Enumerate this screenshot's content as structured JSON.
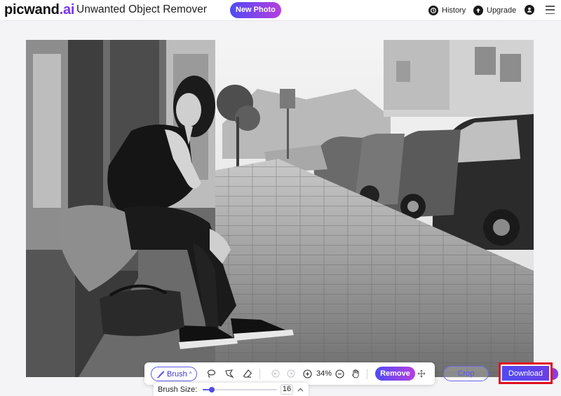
{
  "header": {
    "logo_main": "picwand",
    "logo_accent": ".ai",
    "app_title": "Unwanted Object Remover",
    "new_photo_label": "New Photo",
    "history_label": "History",
    "upgrade_label": "Upgrade",
    "icons": {
      "history": "history-clock-icon",
      "upgrade": "upgrade-arrow-icon",
      "account": "user-avatar-icon",
      "menu": "hamburger-menu-icon"
    }
  },
  "toolbar": {
    "brush_label": "Brush",
    "zoom_level": "34%",
    "remove_label": "Remove",
    "icons": [
      "brush-icon",
      "chevron-up-icon",
      "lasso-icon",
      "polygon-lasso-icon",
      "eraser-icon",
      "undo-icon",
      "redo-icon",
      "zoom-in-icon",
      "zoom-out-icon",
      "hand-pan-icon",
      "move-icon"
    ]
  },
  "actions": {
    "crop_label": "Crop",
    "download_label": "Download"
  },
  "brush_size": {
    "label": "Brush Size:",
    "value": "16",
    "slider_fraction": 0.12
  },
  "colors": {
    "accent_start": "#4f4bf2",
    "accent_end": "#b63fe0",
    "logo_accent": "#7a36f0",
    "highlight_border": "#e0101e"
  }
}
